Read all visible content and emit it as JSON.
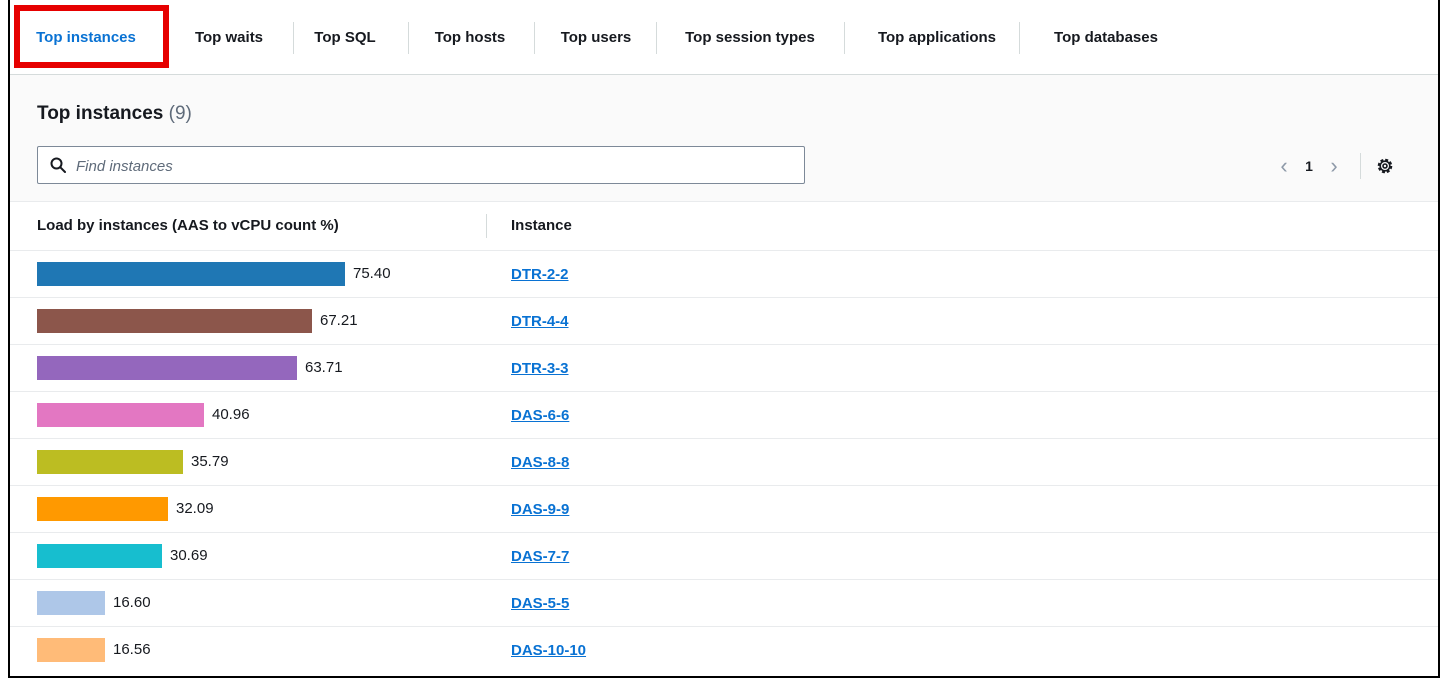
{
  "tabs": [
    {
      "label": "Top instances",
      "active": true
    },
    {
      "label": "Top waits"
    },
    {
      "label": "Top SQL"
    },
    {
      "label": "Top hosts"
    },
    {
      "label": "Top users"
    },
    {
      "label": "Top session types"
    },
    {
      "label": "Top applications"
    },
    {
      "label": "Top databases"
    }
  ],
  "panel": {
    "title": "Top instances",
    "count": "(9)",
    "search_placeholder": "Find instances"
  },
  "pagination": {
    "prev": "‹",
    "page": "1",
    "next": "›"
  },
  "table": {
    "columns": [
      "Load by instances (AAS to vCPU count %)",
      "Instance"
    ],
    "max_value": 75.4,
    "rows": [
      {
        "value": "75.40",
        "instance": "DTR-2-2",
        "color": "#1f77b4"
      },
      {
        "value": "67.21",
        "instance": "DTR-4-4",
        "color": "#8c564b"
      },
      {
        "value": "63.71",
        "instance": "DTR-3-3",
        "color": "#9467bd"
      },
      {
        "value": "40.96",
        "instance": "DAS-6-6",
        "color": "#e377c2"
      },
      {
        "value": "35.79",
        "instance": "DAS-8-8",
        "color": "#bcbd22"
      },
      {
        "value": "32.09",
        "instance": "DAS-9-9",
        "color": "#ff9900"
      },
      {
        "value": "30.69",
        "instance": "DAS-7-7",
        "color": "#17becf"
      },
      {
        "value": "16.60",
        "instance": "DAS-5-5",
        "color": "#aec7e8"
      },
      {
        "value": "16.56",
        "instance": "DAS-10-10",
        "color": "#ffbb78"
      }
    ]
  }
}
